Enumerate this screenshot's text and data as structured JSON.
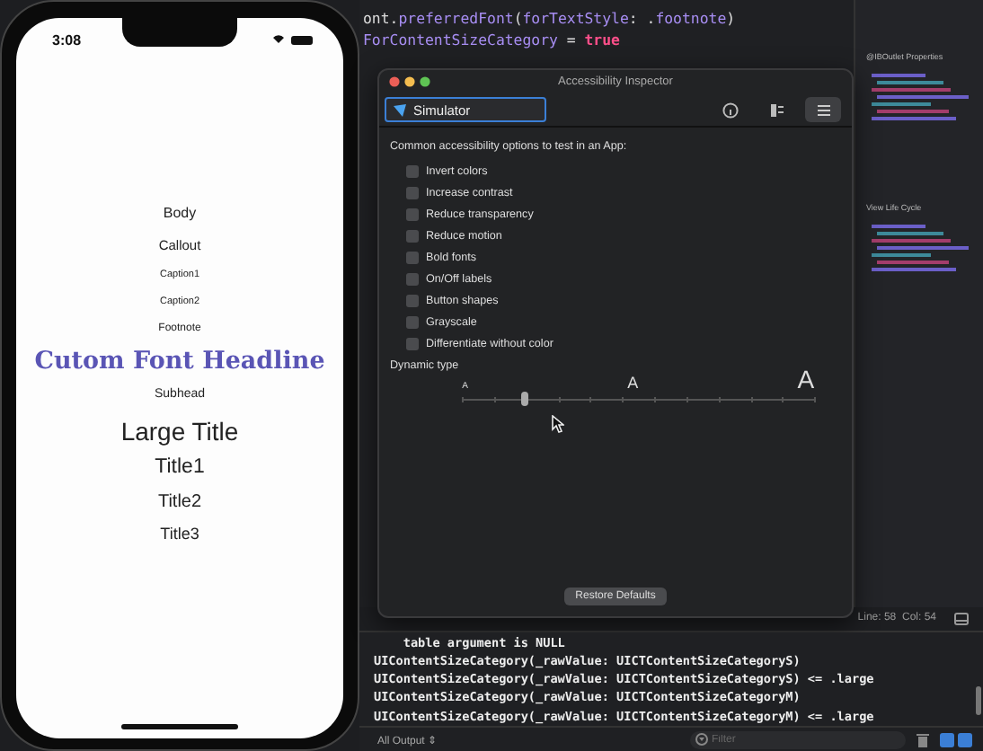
{
  "simulator": {
    "time": "3:08",
    "labels": [
      {
        "text": "Body"
      },
      {
        "text": "Callout"
      },
      {
        "text": "Caption1"
      },
      {
        "text": "Caption2"
      },
      {
        "text": "Footnote"
      },
      {
        "text": "Cutom Font Headline"
      },
      {
        "text": "Subhead"
      },
      {
        "text": "Large Title"
      },
      {
        "text": "Title1"
      },
      {
        "text": "Title2"
      },
      {
        "text": "Title3"
      }
    ]
  },
  "editor": {
    "code_lines": [
      [
        {
          "text": "ont.",
          "kind": "plain"
        },
        {
          "text": "preferredFont",
          "kind": "method"
        },
        {
          "text": "(",
          "kind": "plain"
        },
        {
          "text": "forTextStyle",
          "kind": "method"
        },
        {
          "text": ": .",
          "kind": "plain"
        },
        {
          "text": "footnote",
          "kind": "method"
        },
        {
          "text": ")",
          "kind": "plain"
        }
      ],
      [
        {
          "text": "ForContentSizeCategory",
          "kind": "method"
        },
        {
          "text": " = ",
          "kind": "plain"
        },
        {
          "text": "true",
          "kind": "keyword"
        }
      ]
    ],
    "minimap_headings": [
      "@IBOutlet Properties",
      "View Life Cycle"
    ],
    "cursor_position": "Line: 58  Col: 54"
  },
  "inspector": {
    "title": "Accessibility Inspector",
    "target": "Simulator",
    "heading": "Common accessibility options to test in an App:",
    "options": [
      {
        "label": "Invert colors",
        "checked": false
      },
      {
        "label": "Increase contrast",
        "checked": false
      },
      {
        "label": "Reduce transparency",
        "checked": false
      },
      {
        "label": "Reduce motion",
        "checked": false
      },
      {
        "label": "Bold fonts",
        "checked": false
      },
      {
        "label": "On/Off labels",
        "checked": false
      },
      {
        "label": "Button shapes",
        "checked": false
      },
      {
        "label": "Grayscale",
        "checked": false
      },
      {
        "label": "Differentiate without color",
        "checked": false
      }
    ],
    "dynamic_type": {
      "label": "Dynamic type",
      "small_glyph": "A",
      "mid_glyph": "A",
      "large_glyph": "A",
      "level": 0.18
    },
    "restore_button": "Restore Defaults"
  },
  "console": {
    "lines": [
      "    table argument is NULL",
      "UIContentSizeCategory(_rawValue: UICTContentSizeCategoryS)",
      "UIContentSizeCategory(_rawValue: UICTContentSizeCategoryS) <= .large",
      "UIContentSizeCategory(_rawValue: UICTContentSizeCategoryM)",
      "UIContentSizeCategory(_rawValue: UICTContentSizeCategoryM) <= .large"
    ],
    "output_selector": "All Output ⇕",
    "filter_placeholder": "Filter"
  }
}
